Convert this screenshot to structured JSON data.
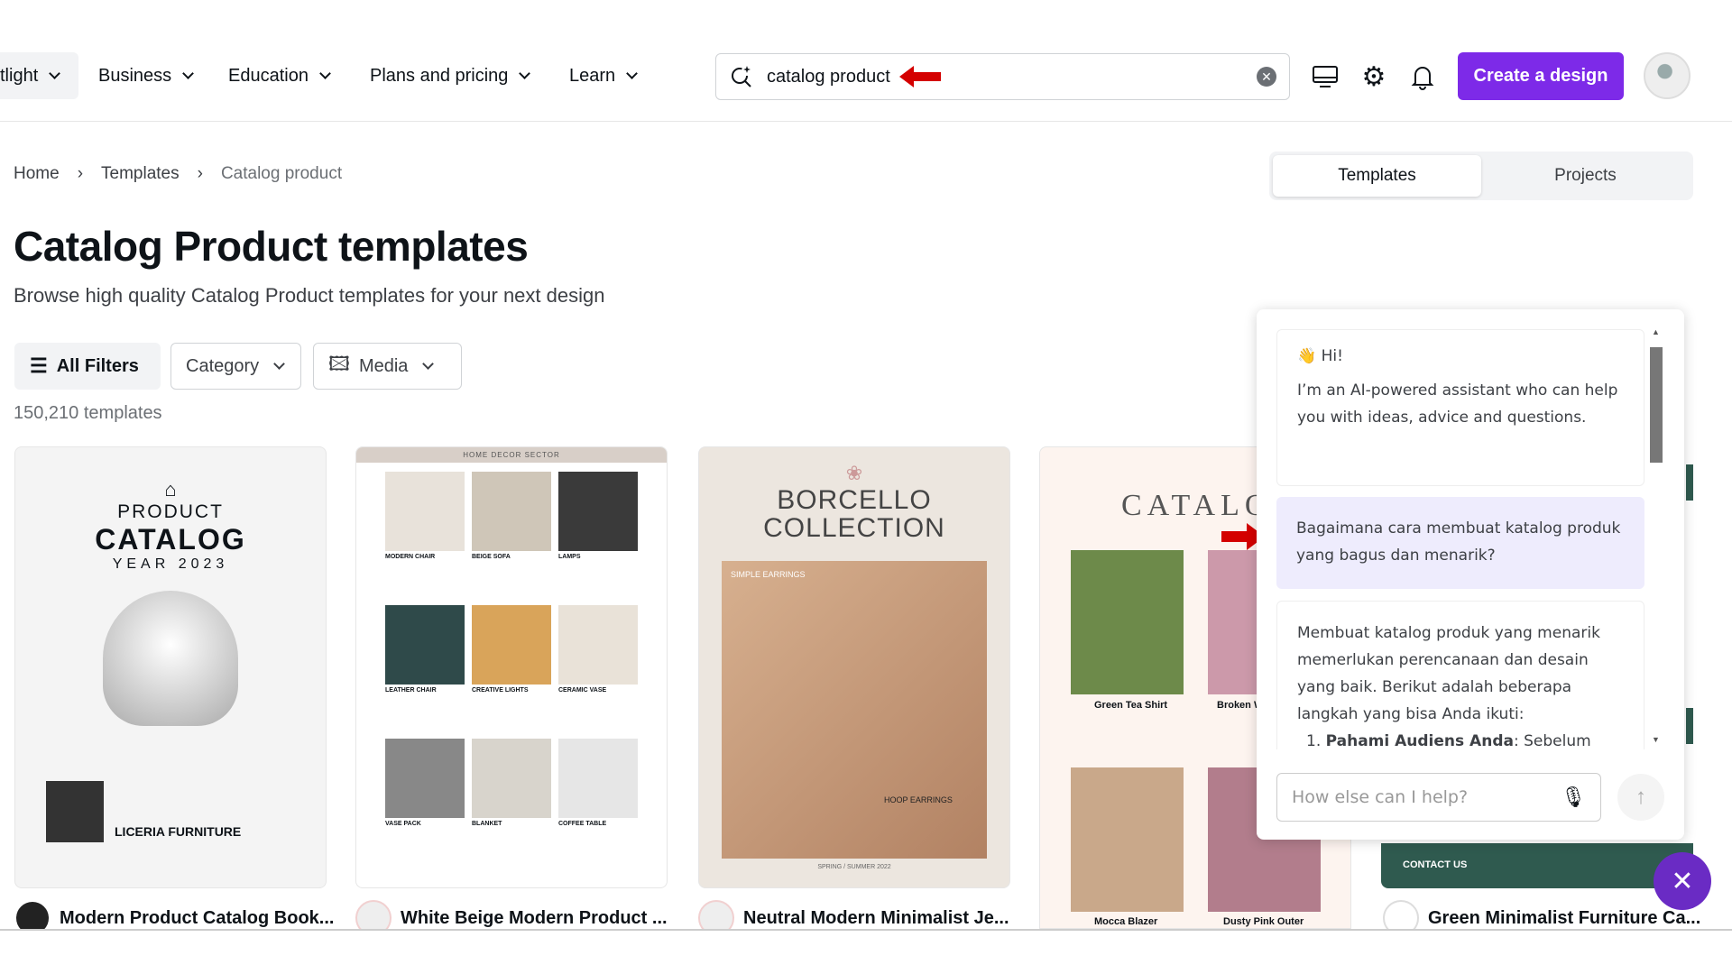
{
  "nav": {
    "items": [
      "tlight",
      "Business",
      "Education",
      "Plans and pricing",
      "Learn"
    ]
  },
  "search": {
    "value": "catalog product"
  },
  "header": {
    "create_label": "Create a design"
  },
  "breadcrumb": [
    "Home",
    "Templates",
    "Catalog product"
  ],
  "view_tabs": [
    "Templates",
    "Projects"
  ],
  "page": {
    "title": "Catalog Product templates",
    "subtitle": "Browse high quality Catalog Product templates for your next design",
    "count": "150,210 templates"
  },
  "filters": {
    "all": "All Filters",
    "category": "Category",
    "media": "Media"
  },
  "cards": [
    {
      "title": "Modern Product Catalog Book...",
      "art": {
        "l1": "PRODUCT",
        "l2": "CATALOG",
        "l3": "YEAR 2023",
        "brand": "LICERIA FURNITURE"
      }
    },
    {
      "title": "White Beige Modern Product ...",
      "art": {
        "head": "HOME DECOR SECTOR",
        "items": [
          "MODERN CHAIR",
          "BEIGE SOFA",
          "LAMPS",
          "LEATHER CHAIR",
          "CREATIVE LIGHTS",
          "CERAMIC VASE",
          "VASE PACK",
          "BLANKET",
          "COFFEE TABLE"
        ]
      }
    },
    {
      "title": "Neutral Modern Minimalist Je...",
      "art": {
        "l1": "BORCELLO",
        "l2": "COLLECTION",
        "a": "SIMPLE EARRINGS",
        "b": "HOOP EARRINGS",
        "foot": "SPRING / SUMMER 2022"
      }
    },
    {
      "title": "",
      "art": {
        "head": "CATALOG",
        "items": [
          "Green Tea Shirt",
          "Broken W",
          "Mocca Blazer",
          "Dusty Pink Outer"
        ]
      }
    },
    {
      "title": "Green Minimalist Furniture Ca...",
      "art": {
        "contact": "CONTACT US"
      }
    }
  ],
  "chat": {
    "greeting": "Hi!",
    "intro": "I’m an AI-powered assistant who can help you with ideas, advice and questions.",
    "user_msg": "Bagaimana cara membuat katalog produk yang bagus dan menarik?",
    "reply": "Membuat katalog produk yang menarik memerlukan perencanaan dan desain yang baik. Berikut adalah beberapa langkah yang bisa Anda ikuti:",
    "reply_item_bold": "Pahami Audiens Anda",
    "reply_item_rest": ": Sebelum",
    "input_placeholder": "How else can I help?"
  },
  "colors": {
    "brand": "#7d2ae8",
    "annotation_arrow": "#d40000",
    "user_bubble": "#eeecfd"
  }
}
